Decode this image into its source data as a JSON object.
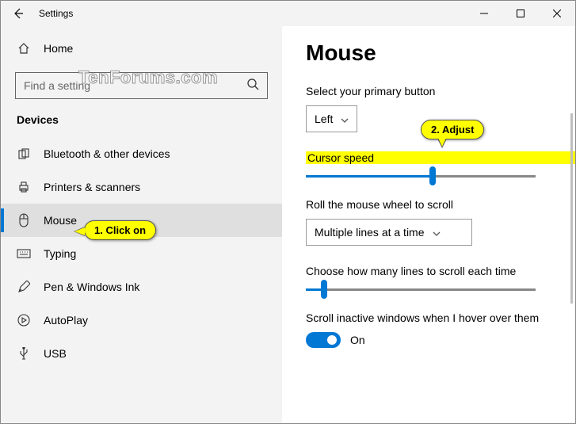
{
  "window": {
    "title": "Settings"
  },
  "sidebar": {
    "home": "Home",
    "search_placeholder": "Find a setting",
    "section": "Devices",
    "items": [
      {
        "label": "Bluetooth & other devices"
      },
      {
        "label": "Printers & scanners"
      },
      {
        "label": "Mouse"
      },
      {
        "label": "Typing"
      },
      {
        "label": "Pen & Windows Ink"
      },
      {
        "label": "AutoPlay"
      },
      {
        "label": "USB"
      }
    ]
  },
  "main": {
    "heading": "Mouse",
    "primary_button_label": "Select your primary button",
    "primary_button_value": "Left",
    "cursor_speed_label": "Cursor speed",
    "cursor_speed_value_pct": 55,
    "scroll_label": "Roll the mouse wheel to scroll",
    "scroll_value": "Multiple lines at a time",
    "lines_label": "Choose how many lines to scroll each time",
    "lines_value_pct": 8,
    "inactive_label": "Scroll inactive windows when I hover over them",
    "inactive_value": "On"
  },
  "callouts": {
    "c1": "1. Click on",
    "c2": "2. Adjust"
  },
  "watermark": "TenForums.com"
}
